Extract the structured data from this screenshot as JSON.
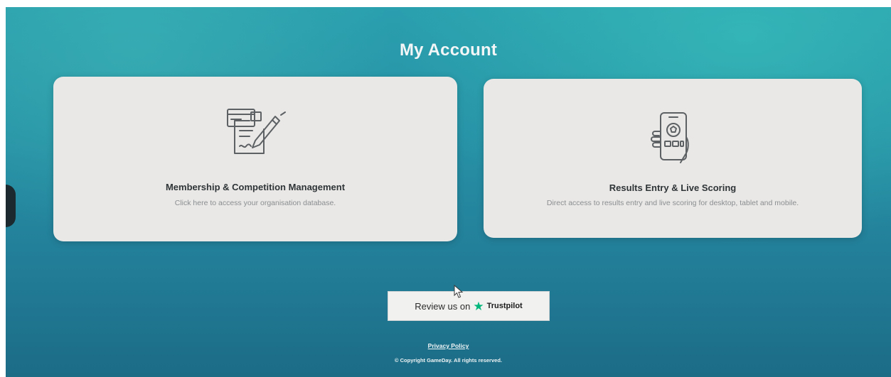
{
  "page": {
    "title": "My Account"
  },
  "cards": [
    {
      "icon": "document-pen-icon",
      "title": "Membership & Competition Management",
      "description": "Click here to access your organisation database."
    },
    {
      "icon": "mobile-scoring-icon",
      "title": "Results Entry & Live Scoring",
      "description": "Direct access to results entry and live scoring for desktop, tablet and mobile."
    }
  ],
  "review": {
    "text": "Review us on",
    "star_icon": "star-icon",
    "brand": "Trustpilot",
    "star_color": "#00b67a"
  },
  "footer": {
    "privacy": "Privacy Policy",
    "copyright": "© Copyright GameDay. All rights reserved."
  },
  "colors": {
    "background": "#2792a6",
    "card": "#e9e8e6",
    "title": "#f2f6f7"
  }
}
